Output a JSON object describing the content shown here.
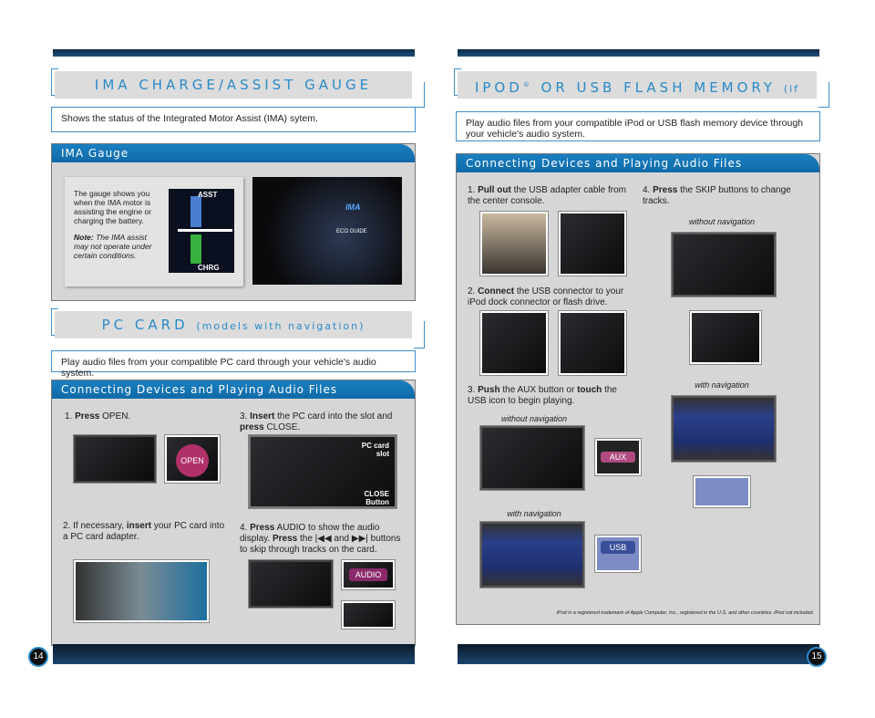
{
  "left": {
    "title": "IMA CHARGE/ASSIST GAUGE",
    "subtitle": "Shows the status of the Integrated Motor Assist (IMA) sytem.",
    "gauge_panel": {
      "header": "IMA Gauge",
      "text": "The gauge shows you when the IMA motor is assisting the engine or charging the battery.",
      "note_label": "Note:",
      "note": "The IMA assist may not operate under certain conditions.",
      "assist_label": "ASST",
      "charge_label": "CHRG",
      "eco_guide": "ECO GUIDE",
      "ima_logo": "IMA"
    },
    "pc_title": "PC CARD",
    "pc_title_suffix": "(models with navigation)",
    "pc_desc": "Play audio files from your compatible PC card through your vehicle's audio system.",
    "pc_panel": {
      "header": "Connecting Devices and Playing Audio Files",
      "steps": [
        {
          "num": "1.",
          "bold": "Press",
          "text": " OPEN."
        },
        {
          "num": "2.",
          "pre": "If necessary, ",
          "bold": "insert",
          "text": " your PC card into a PC card adapter."
        },
        {
          "num": "3.",
          "bold": "Insert",
          "text": " the PC card into the slot and ",
          "bold2": "press",
          "text2": " CLOSE."
        },
        {
          "num": "4.",
          "bold": "Press",
          "text": " AUDIO to show the audio display. ",
          "bold2": "Press",
          "text2": " the |◀◀ and ▶▶| buttons to skip through tracks on the card."
        }
      ],
      "open_button": "OPEN",
      "slot_label": "PC card slot",
      "close_label": "CLOSE Button",
      "audio_button": "AUDIO"
    },
    "page_number": "14"
  },
  "right": {
    "title": "IPOD",
    "title_mark": "®",
    "title_rest": " OR USB FLASH MEMORY",
    "title_suffix": "(if equipped)",
    "desc": "Play audio files from your compatible iPod or USB flash memory device through your vehicle's audio system.",
    "panel": {
      "header": "Connecting Devices and Playing Audio Files",
      "steps": [
        {
          "num": "1.",
          "bold": "Pull out",
          "text": " the USB adapter cable from the center console."
        },
        {
          "num": "2.",
          "bold": "Connect",
          "text": " the USB connector to your iPod dock connector or flash drive."
        },
        {
          "num": "3.",
          "bold": "Push",
          "text": " the AUX button or ",
          "bold2": "touch",
          "text2": " the USB icon to begin playing."
        },
        {
          "num": "4.",
          "bold": "Press",
          "text": " the SKIP buttons to change tracks."
        }
      ],
      "without_nav": "without navigation",
      "with_nav": "with navigation",
      "aux_button": "AUX",
      "usb_button": "USB",
      "footnote": "iPod is a registered trademark of Apple Computer, Inc., registered in the U.S. and other countries. iPod not included."
    },
    "page_number": "15"
  },
  "colors": {
    "accent": "#2a8ac7",
    "header_blue": "#1477b8",
    "panel_gray": "#d6d6d6"
  }
}
